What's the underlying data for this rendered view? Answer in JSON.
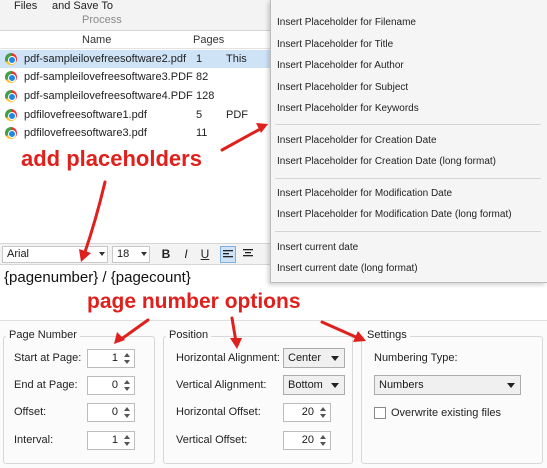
{
  "ribbon": {
    "files_label": "Files",
    "save_label": "and Save To",
    "group_label": "Process"
  },
  "file_list": {
    "headers": {
      "name": "Name",
      "pages": "Pages"
    },
    "rows": [
      {
        "name": "pdf-sampleilovefreesoftware2.pdf",
        "pages": "1",
        "extra": "This"
      },
      {
        "name": "pdf-sampleilovefreesoftware3.PDF",
        "pages": "82",
        "extra": ""
      },
      {
        "name": "pdf-sampleilovefreesoftware4.PDF",
        "pages": "128",
        "extra": ""
      },
      {
        "name": "pdfilovefreesoftware1.pdf",
        "pages": "5",
        "extra": "PDF"
      },
      {
        "name": "pdfilovefreesoftware3.pdf",
        "pages": "11",
        "extra": ""
      }
    ]
  },
  "context_menu": {
    "items": [
      "Insert Placeholder for Filename",
      "Insert Placeholder for Title",
      "Insert Placeholder for Author",
      "Insert Placeholder for Subject",
      "Insert Placeholder for Keywords",
      "Insert Placeholder for Creation Date",
      "Insert Placeholder for Creation Date (long format)",
      "Insert Placeholder for Modification Date",
      "Insert Placeholder for Modification Date (long format)",
      "Insert current date",
      "Insert current date (long format)"
    ]
  },
  "toolbar": {
    "font": "Arial",
    "size": "18",
    "bold": "B",
    "italic": "I",
    "underline": "U"
  },
  "editor": {
    "text": "{pagenumber} / {pagecount}"
  },
  "page_number": {
    "title": "Page Number",
    "start_label": "Start at Page:",
    "start_value": "1",
    "end_label": "End at Page:",
    "end_value": "0",
    "offset_label": "Offset:",
    "offset_value": "0",
    "interval_label": "Interval:",
    "interval_value": "1"
  },
  "position": {
    "title": "Position",
    "h_align_label": "Horizontal Alignment:",
    "h_align_value": "Center",
    "v_align_label": "Vertical Alignment:",
    "v_align_value": "Bottom",
    "h_offset_label": "Horizontal Offset:",
    "h_offset_value": "20",
    "v_offset_label": "Vertical Offset:",
    "v_offset_value": "20"
  },
  "settings": {
    "title": "Settings",
    "numbering_label": "Numbering Type:",
    "numbering_value": "Numbers",
    "overwrite_label": "Overwrite existing files",
    "overwrite_checked": false
  },
  "annotations": {
    "add_placeholders": "add placeholders",
    "page_number_options": "page number options"
  },
  "colors": {
    "annotation": "#e0201c",
    "selection": "#cfe3f7",
    "menu_bg": "#f5f5f5"
  }
}
